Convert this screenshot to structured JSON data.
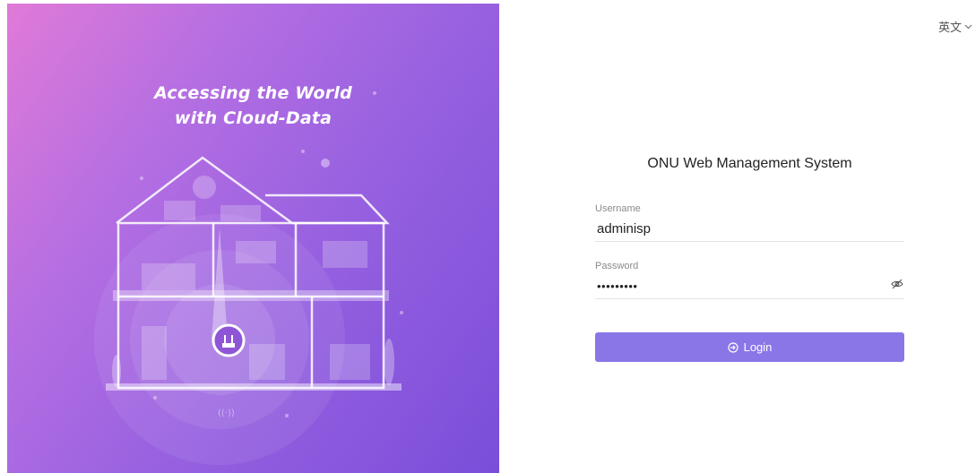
{
  "hero": {
    "title_line1": "Accessing the World",
    "title_line2": "with Cloud-Data",
    "gradient_colors": [
      "#e07ad8",
      "#9660e0",
      "#7a4ed9"
    ]
  },
  "language": {
    "selected": "英文",
    "icon": "chevron-down-icon"
  },
  "login": {
    "title": "ONU Web Management System",
    "username_label": "Username",
    "username_value": "adminisp",
    "password_label": "Password",
    "password_value": "•••••••••",
    "password_toggle_icon": "eye-off-icon",
    "button_label": "Login",
    "button_icon": "login-icon",
    "accent_color": "#8b76e7"
  }
}
